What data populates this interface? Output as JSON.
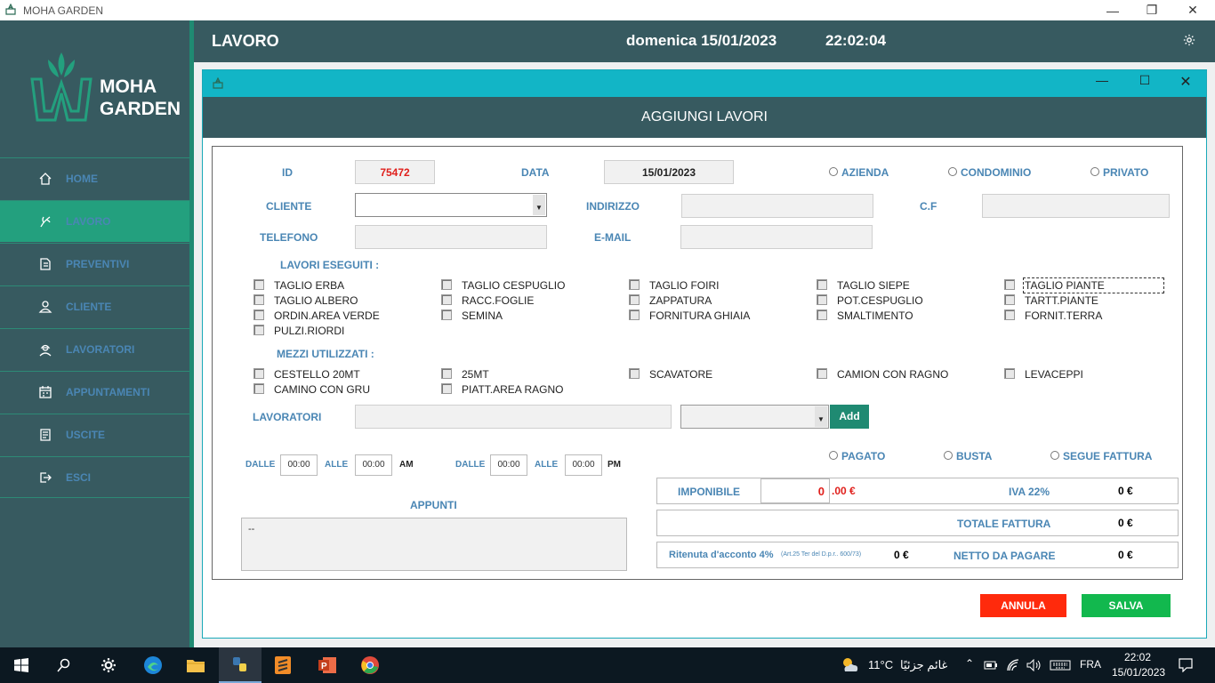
{
  "window": {
    "title": "MOHA GARDEN"
  },
  "logo": {
    "line1": "MOHA",
    "line2": "GARDEN"
  },
  "nav": [
    {
      "label": "HOME",
      "icon": "home-icon"
    },
    {
      "label": "LAVORO",
      "icon": "plant-icon"
    },
    {
      "label": "PREVENTIVI",
      "icon": "documents-icon"
    },
    {
      "label": "CLIENTE",
      "icon": "person-icon"
    },
    {
      "label": "LAVORATORI",
      "icon": "workers-icon"
    },
    {
      "label": "APPUNTAMENTI",
      "icon": "calendar-icon"
    },
    {
      "label": "USCITE",
      "icon": "notes-icon"
    },
    {
      "label": "ESCI",
      "icon": "exit-icon"
    }
  ],
  "topbar": {
    "section": "LAVORO",
    "date": "domenica 15/01/2023",
    "time": "22:02:04"
  },
  "dialog": {
    "header": "AGGIUNGI LAVORI",
    "id_label": "ID",
    "id_value": "75472",
    "data_label": "DATA",
    "data_value": "15/01/2023",
    "types": [
      "AZIENDA",
      "CONDOMINIO",
      "PRIVATO"
    ],
    "cliente_label": "CLIENTE",
    "indirizzo_label": "INDIRIZZO",
    "cf_label": "C.F",
    "telefono_label": "TELEFONO",
    "email_label": "E-MAIL",
    "lavori_label": "LAVORI ESEGUITI :",
    "lavori": [
      "TAGLIO ERBA",
      "TAGLIO CESPUGLIO",
      "TAGLIO FOIRI",
      "TAGLIO SIEPE",
      "TAGLIO PIANTE",
      "TAGLIO ALBERO",
      "RACC.FOGLIE",
      "ZAPPATURA",
      "POT.CESPUGLIO",
      "TARTT.PIANTE",
      "ORDIN.AREA VERDE",
      "SEMINA",
      "FORNITURA GHIAIA",
      "SMALTIMENTO",
      "FORNIT.TERRA",
      "PULZI.RIORDI"
    ],
    "mezzi_label": "MEZZI UTILIZZATI :",
    "mezzi": [
      "CESTELLO 20MT",
      "25MT",
      "SCAVATORE",
      "CAMION CON RAGNO",
      "LEVACEPPI",
      "CAMINO CON GRU",
      "PIATT.AREA RAGNO"
    ],
    "lavoratori_label": "LAVORATORI",
    "add_label": "Add",
    "dalle": "DALLE",
    "alle": "ALLE",
    "time_am_from": "00:00",
    "time_am_to": "00:00",
    "am": "AM",
    "time_pm_from": "00:00",
    "time_pm_to": "00:00",
    "pm": "PM",
    "payments": [
      "PAGATO",
      "BUSTA",
      "SEGUE FATTURA"
    ],
    "appunti_label": "APPUNTI",
    "appunti_value": "--",
    "imponibile_label": "IMPONIBILE",
    "imponibile_value": "0",
    "imponibile_suffix": ".00 €",
    "iva_label": "IVA 22%",
    "iva_value": "0 €",
    "totale_label": "TOTALE FATTURA",
    "totale_value": "0 €",
    "ritenuta_label": "Ritenuta d'acconto 4%",
    "ritenuta_note": "(Art.25 Ter del D.p.r.. 600/73)",
    "ritenuta_value": "0 €",
    "netto_label": "NETTO DA PAGARE",
    "netto_value": "0 €",
    "annulla_label": "ANNULA",
    "salva_label": "SALVA"
  },
  "taskbar": {
    "weather": "11°C",
    "weather_text": "غائم جزئيًا",
    "lang": "FRA",
    "time": "22:02",
    "date": "15/01/2023"
  },
  "colors": {
    "sidebar": "#375a60",
    "active": "#23a07e",
    "dialog_title": "#12b5c6",
    "annulla": "#ff2a0c",
    "salva": "#12b84e"
  }
}
